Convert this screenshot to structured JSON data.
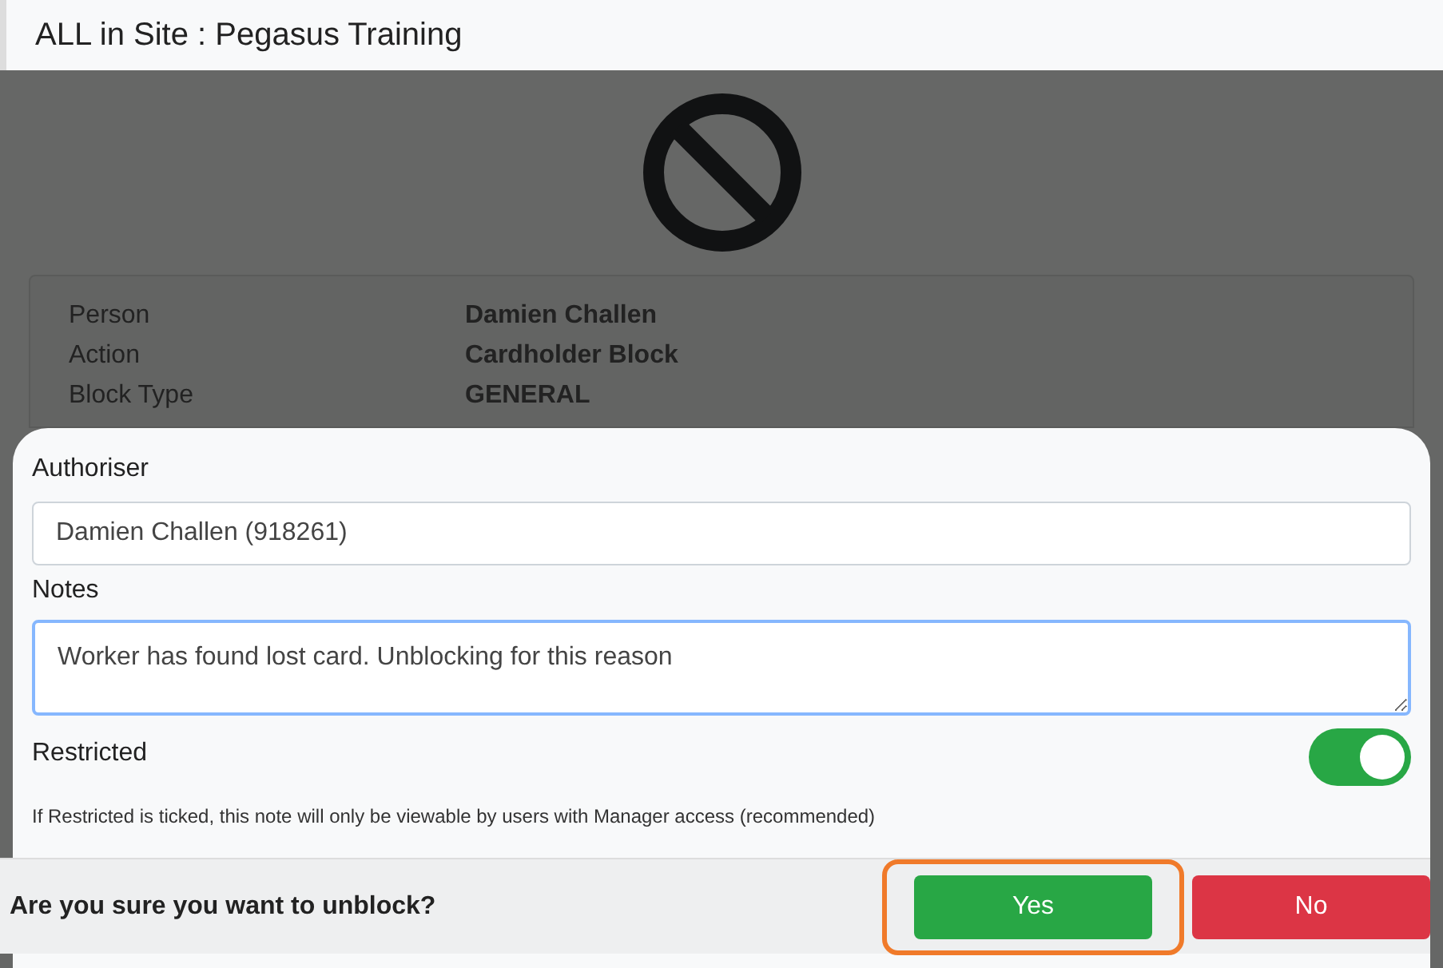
{
  "window": {
    "title": "ALL in Site : Pegasus Training"
  },
  "details": [
    {
      "label": "Person",
      "value": "Damien Challen"
    },
    {
      "label": "Action",
      "value": "Cardholder Block"
    },
    {
      "label": "Block Type",
      "value": "GENERAL"
    }
  ],
  "form": {
    "authoriser": {
      "label": "Authoriser",
      "value": "Damien Challen (918261)"
    },
    "notes": {
      "label": "Notes",
      "value": "Worker has found lost card. Unblocking for this reason",
      "focused": true
    },
    "restricted": {
      "label": "Restricted",
      "on": true
    },
    "hint": "If Restricted is ticked, this note will only be viewable by users with Manager access (recommended)"
  },
  "confirm": {
    "question": "Are you sure you want to unblock?",
    "buttons": [
      {
        "label": "Yes",
        "kind": "confirm",
        "highlighted": true
      },
      {
        "label": "No",
        "kind": "cancel",
        "highlighted": false
      }
    ]
  }
}
